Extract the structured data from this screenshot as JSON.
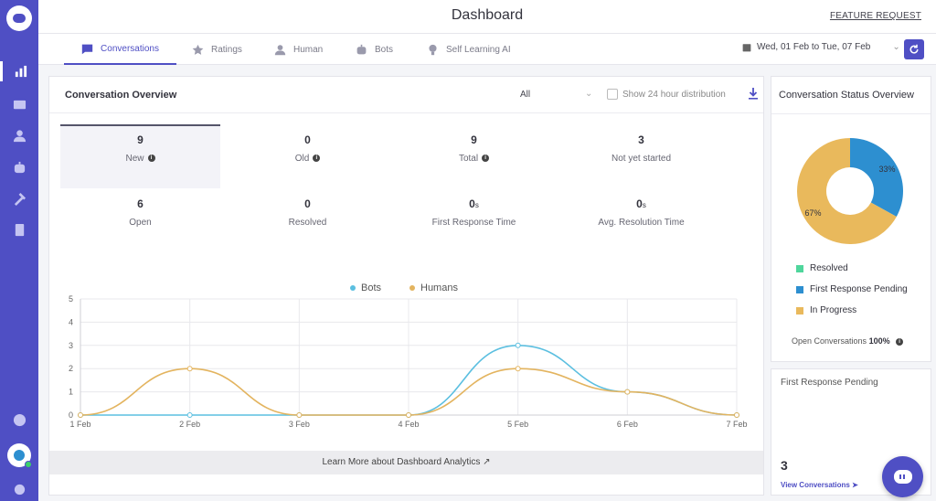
{
  "header": {
    "title": "Dashboard",
    "feature_request": "FEATURE REQUEST"
  },
  "tabs": [
    {
      "label": "Conversations",
      "icon": "chat-icon"
    },
    {
      "label": "Ratings",
      "icon": "star-icon"
    },
    {
      "label": "Human",
      "icon": "person-icon"
    },
    {
      "label": "Bots",
      "icon": "bot-icon"
    },
    {
      "label": "Self Learning AI",
      "icon": "bulb-icon"
    }
  ],
  "date_range": "Wed, 01 Feb to Tue, 07 Feb",
  "overview": {
    "title": "Conversation Overview",
    "filter": "All",
    "checkbox_label": "Show 24 hour distribution",
    "stats": [
      {
        "value": "9",
        "label": "New",
        "info": true
      },
      {
        "value": "0",
        "label": "Old",
        "info": true
      },
      {
        "value": "9",
        "label": "Total",
        "info": true
      },
      {
        "value": "3",
        "label": "Not yet started",
        "info": false
      },
      {
        "value": "6",
        "label": "Open",
        "info": false
      },
      {
        "value": "0",
        "label": "Resolved",
        "info": false
      },
      {
        "value": "0",
        "unit": "s",
        "label": "First Response Time",
        "info": false
      },
      {
        "value": "0",
        "unit": "s",
        "label": "Avg. Resolution Time",
        "info": false
      }
    ],
    "learn_more": "Learn More about Dashboard Analytics"
  },
  "chart_data": {
    "type": "line",
    "x": [
      "1 Feb",
      "2 Feb",
      "3 Feb",
      "4 Feb",
      "5 Feb",
      "6 Feb",
      "7 Feb"
    ],
    "yticks": [
      "0",
      "1",
      "2",
      "3",
      "4",
      "5"
    ],
    "ylim": [
      0,
      5
    ],
    "grid": true,
    "legend_position": "top",
    "series": [
      {
        "name": "Bots",
        "color": "#5bbfe0",
        "values": [
          0,
          0,
          0,
          0,
          3,
          1,
          0
        ]
      },
      {
        "name": "Humans",
        "color": "#e3b45f",
        "values": [
          0,
          2,
          0,
          0,
          2,
          1,
          0
        ]
      }
    ]
  },
  "status_overview": {
    "title": "Conversation Status Overview",
    "donut": {
      "type": "pie",
      "slices": [
        {
          "label": "Resolved",
          "value": 0,
          "color": "#4fd69c"
        },
        {
          "label": "First Response Pending",
          "value": 33,
          "color": "#2d8fd0",
          "display": "33%"
        },
        {
          "label": "In Progress",
          "value": 67,
          "color": "#e9b95c",
          "display": "67%"
        }
      ]
    },
    "open_label": "Open Conversations",
    "open_value": "100%"
  },
  "first_response": {
    "title": "First Response Pending",
    "value": "3",
    "link": "View Conversations"
  }
}
